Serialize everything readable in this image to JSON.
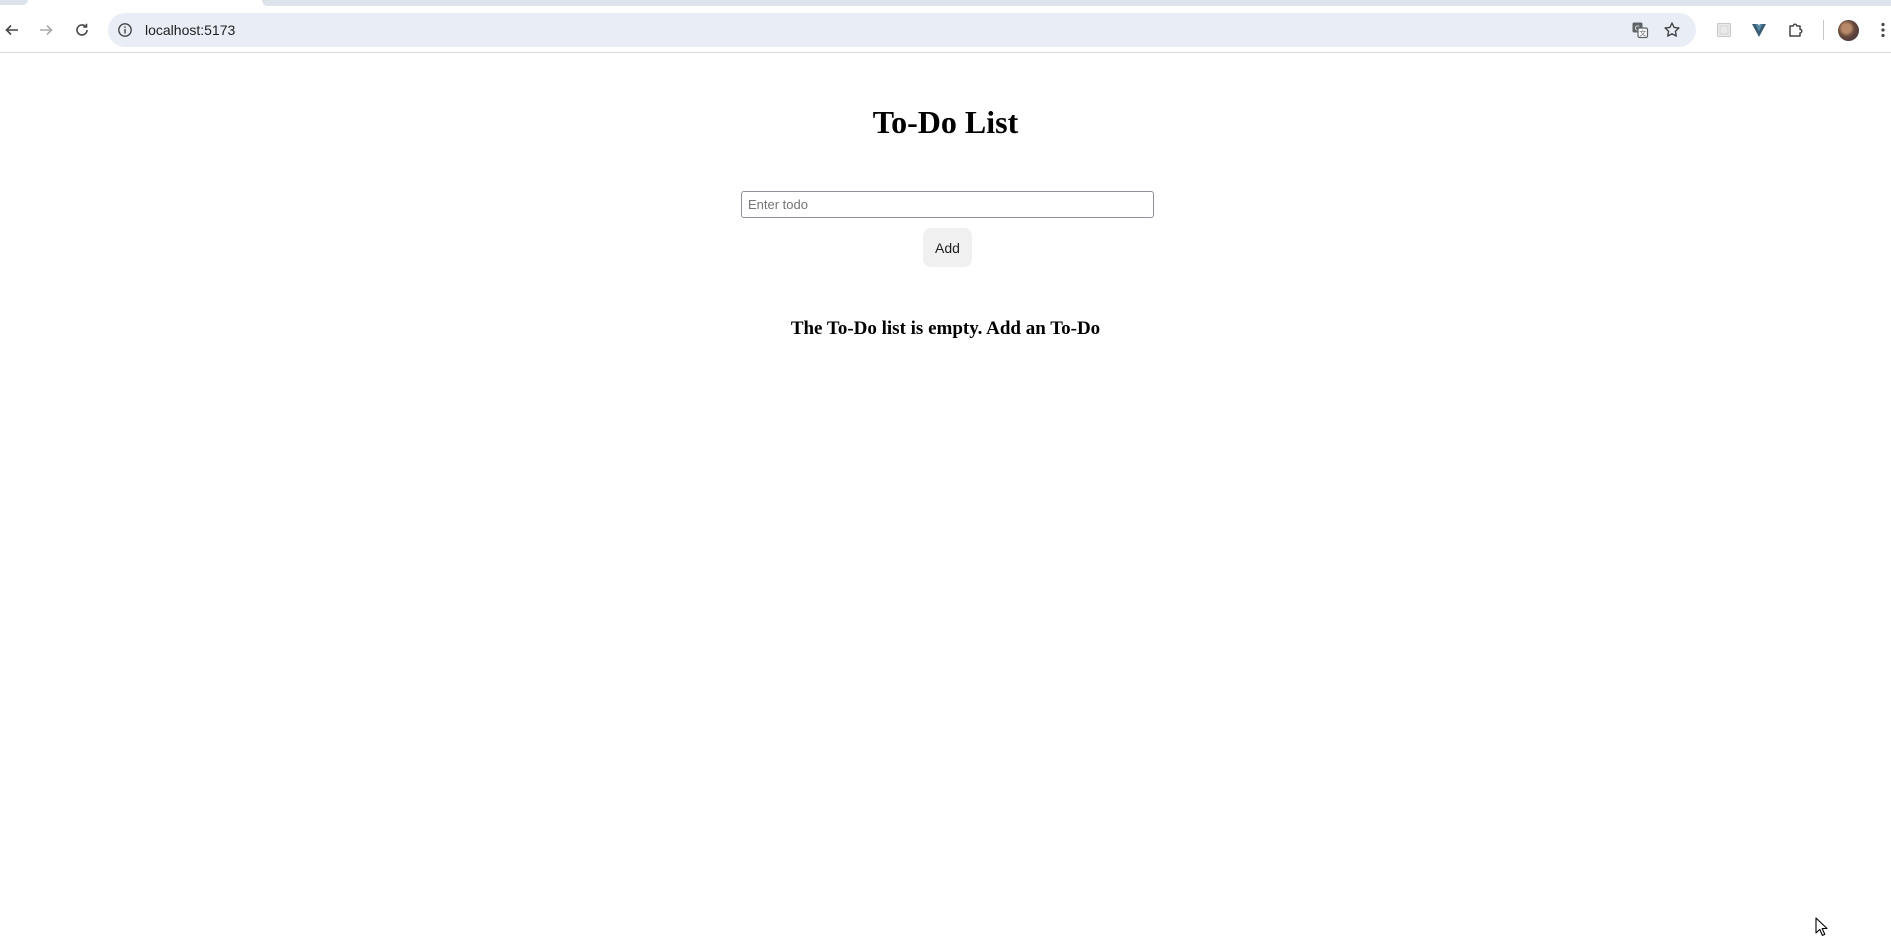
{
  "browser": {
    "url": "localhost:5173",
    "icons": [
      "back-arrow-icon",
      "forward-arrow-icon",
      "reload-icon",
      "info-icon",
      "translate-icon",
      "star-icon",
      "extension-icon",
      "vuetify-icon",
      "puzzle-icon",
      "avatar",
      "kebab-menu-icon"
    ]
  },
  "app": {
    "title": "To-Do List",
    "input": {
      "placeholder": "Enter todo",
      "value": ""
    },
    "add_label": "Add",
    "empty_message": "The To-Do list is empty. Add an To-Do"
  }
}
